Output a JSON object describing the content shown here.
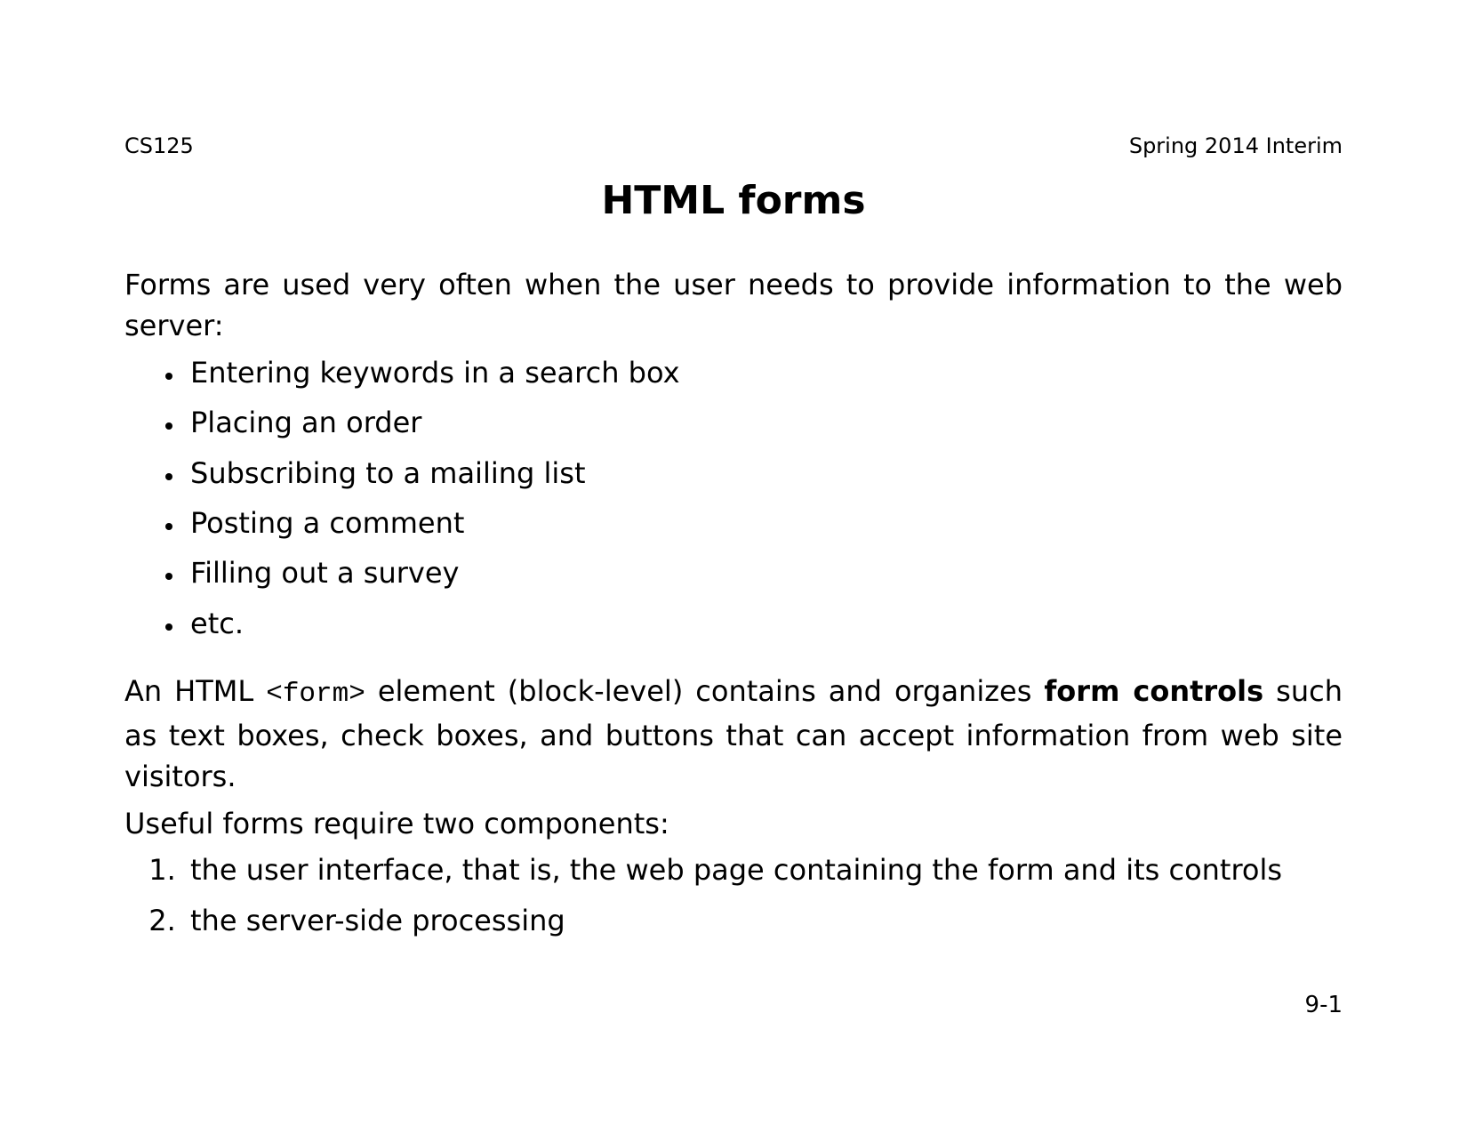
{
  "header": {
    "left": "CS125",
    "right": "Spring 2014 Interim"
  },
  "title": "HTML forms",
  "intro": "Forms are used very often when the user needs to provide information to the web server:",
  "bullets": [
    "Entering keywords in a search box",
    "Placing an order",
    "Subscribing to a mailing list",
    "Posting a comment",
    "Filling out a survey",
    "etc."
  ],
  "para2": {
    "pre": "An HTML ",
    "code": "<form>",
    "mid": " element (block-level) contains and organizes ",
    "bold": "form controls",
    "post": " such as text boxes, check boxes, and buttons that can accept information from web site visitors."
  },
  "para3": "Useful forms require two components:",
  "numbered": [
    "the user interface, that is, the web page containing the form and its controls",
    "the server-side processing"
  ],
  "page_number": "9-1"
}
